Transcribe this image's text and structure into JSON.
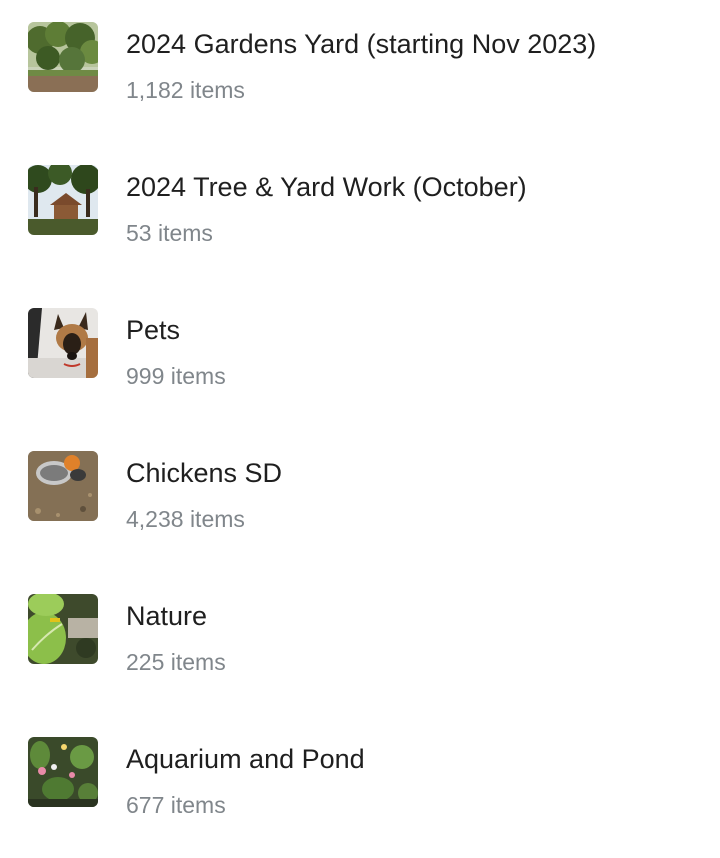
{
  "albums": [
    {
      "title": "2024 Gardens Yard (starting Nov 2023)",
      "count": "1,182 items",
      "thumbnail": "garden-yard-photo"
    },
    {
      "title": "2024 Tree & Yard Work (October)",
      "count": "53 items",
      "thumbnail": "tree-yard-work-photo"
    },
    {
      "title": "Pets",
      "count": "999 items",
      "thumbnail": "dog-photo"
    },
    {
      "title": "Chickens SD",
      "count": "4,238 items",
      "thumbnail": "chickens-photo"
    },
    {
      "title": "Nature",
      "count": "225 items",
      "thumbnail": "nature-leaves-photo"
    },
    {
      "title": "Aquarium and Pond",
      "count": "677 items",
      "thumbnail": "pond-plants-photo"
    }
  ],
  "colors": {
    "title_text": "#1f1f1f",
    "count_text": "#80868b",
    "background": "#ffffff"
  }
}
